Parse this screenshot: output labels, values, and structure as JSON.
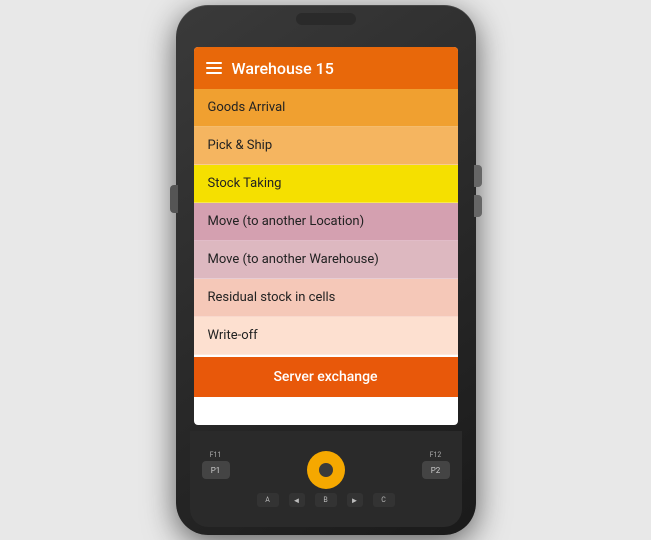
{
  "header": {
    "title": "Warehouse 15",
    "menu_icon": "hamburger-menu"
  },
  "menu_items": [
    {
      "id": "goods-arrival",
      "label": "Goods Arrival",
      "color": "#f0a030"
    },
    {
      "id": "pick-ship",
      "label": "Pick & Ship",
      "color": "#f5b560"
    },
    {
      "id": "stock-taking",
      "label": "Stock Taking",
      "color": "#f5e000"
    },
    {
      "id": "move-location",
      "label": "Move (to another Location)",
      "color": "#d4a0b0"
    },
    {
      "id": "move-warehouse",
      "label": "Move (to another Warehouse)",
      "color": "#ddb8c0"
    },
    {
      "id": "residual-stock",
      "label": "Residual stock in cells",
      "color": "#f5c8b8"
    },
    {
      "id": "write-off",
      "label": "Write-off",
      "color": "#fde0d0"
    }
  ],
  "server_exchange_btn": "Server exchange",
  "keypad": {
    "fn_labels": [
      "F11",
      "F12"
    ],
    "p_buttons": [
      "P1",
      "P2"
    ],
    "abc_buttons": [
      "A",
      "B",
      "C"
    ],
    "arrow_buttons": [
      "◄",
      "►"
    ]
  }
}
